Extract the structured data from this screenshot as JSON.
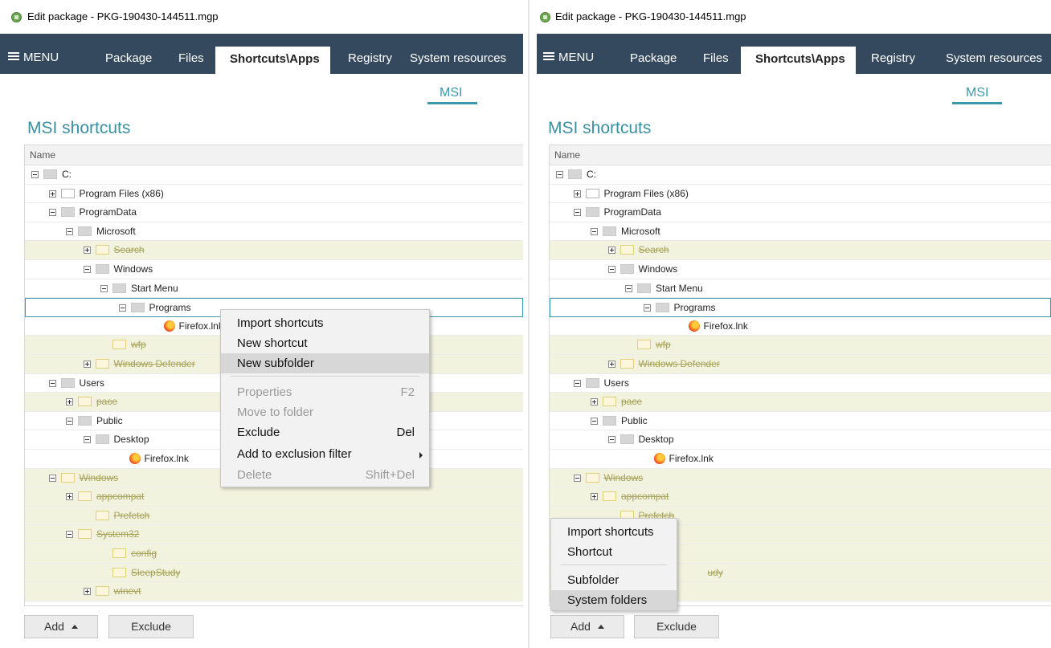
{
  "window": {
    "title": "Edit package - PKG-190430-144511.mgp"
  },
  "nav": {
    "menu_label": "MENU",
    "tabs": [
      "Package",
      "Files",
      "Shortcuts\\Apps",
      "Registry",
      "System resources"
    ],
    "active_tab": "Shortcuts\\Apps"
  },
  "subtab": {
    "label": "MSI"
  },
  "section": {
    "title": "MSI shortcuts"
  },
  "grid": {
    "column_name": "Name"
  },
  "tree_left": [
    {
      "label": "C:",
      "depth": 0,
      "toggle": "minus",
      "icon": "folder-gray",
      "excluded": false
    },
    {
      "label": "Program Files (x86)",
      "depth": 1,
      "toggle": "plus",
      "icon": "folder-outline",
      "excluded": false
    },
    {
      "label": "ProgramData",
      "depth": 1,
      "toggle": "minus",
      "icon": "folder-gray",
      "excluded": false
    },
    {
      "label": "Microsoft",
      "depth": 2,
      "toggle": "minus",
      "icon": "folder-gray",
      "excluded": false
    },
    {
      "label": "Search",
      "depth": 3,
      "toggle": "plus",
      "icon": "folder-excluded",
      "excluded": true
    },
    {
      "label": "Windows",
      "depth": 3,
      "toggle": "minus",
      "icon": "folder-gray",
      "excluded": false
    },
    {
      "label": "Start Menu",
      "depth": 4,
      "toggle": "minus",
      "icon": "folder-gray",
      "excluded": false
    },
    {
      "label": "Programs",
      "depth": 5,
      "toggle": "minus",
      "icon": "folder-gray",
      "excluded": false,
      "selected": true
    },
    {
      "label": "Firefox.lnk",
      "depth": 7,
      "toggle": "none",
      "icon": "firefox",
      "excluded": false
    },
    {
      "label": "wfp",
      "depth": 4,
      "toggle": "none",
      "icon": "folder-excluded",
      "excluded": true
    },
    {
      "label": "Windows Defender",
      "depth": 3,
      "toggle": "plus",
      "icon": "folder-excluded",
      "excluded": true
    },
    {
      "label": "Users",
      "depth": 1,
      "toggle": "minus",
      "icon": "folder-gray",
      "excluded": false
    },
    {
      "label": "pace",
      "depth": 2,
      "toggle": "plus",
      "icon": "folder-excluded",
      "excluded": true
    },
    {
      "label": "Public",
      "depth": 2,
      "toggle": "minus",
      "icon": "folder-gray",
      "excluded": false
    },
    {
      "label": "Desktop",
      "depth": 3,
      "toggle": "minus",
      "icon": "folder-gray",
      "excluded": false
    },
    {
      "label": "Firefox.lnk",
      "depth": 5,
      "toggle": "none",
      "icon": "firefox",
      "excluded": false
    },
    {
      "label": "Windows",
      "depth": 1,
      "toggle": "minus",
      "icon": "folder-excluded",
      "excluded": true
    },
    {
      "label": "appcompat",
      "depth": 2,
      "toggle": "plus",
      "icon": "folder-excluded",
      "excluded": true
    },
    {
      "label": "Prefetch",
      "depth": 3,
      "toggle": "none",
      "icon": "folder-excluded",
      "excluded": true
    },
    {
      "label": "System32",
      "depth": 2,
      "toggle": "minus",
      "icon": "folder-excluded",
      "excluded": true
    },
    {
      "label": "config",
      "depth": 4,
      "toggle": "none",
      "icon": "folder-excluded",
      "excluded": true
    },
    {
      "label": "SleepStudy",
      "depth": 4,
      "toggle": "none",
      "icon": "folder-excluded",
      "excluded": true
    },
    {
      "label": "winevt",
      "depth": 3,
      "toggle": "plus",
      "icon": "folder-excluded",
      "excluded": true
    }
  ],
  "tree_right": [
    {
      "label": "C:",
      "depth": 0,
      "toggle": "minus",
      "icon": "folder-gray",
      "excluded": false
    },
    {
      "label": "Program Files (x86)",
      "depth": 1,
      "toggle": "plus",
      "icon": "folder-outline",
      "excluded": false
    },
    {
      "label": "ProgramData",
      "depth": 1,
      "toggle": "minus",
      "icon": "folder-gray",
      "excluded": false
    },
    {
      "label": "Microsoft",
      "depth": 2,
      "toggle": "minus",
      "icon": "folder-gray",
      "excluded": false
    },
    {
      "label": "Search",
      "depth": 3,
      "toggle": "plus",
      "icon": "folder-excluded",
      "excluded": true
    },
    {
      "label": "Windows",
      "depth": 3,
      "toggle": "minus",
      "icon": "folder-gray",
      "excluded": false
    },
    {
      "label": "Start Menu",
      "depth": 4,
      "toggle": "minus",
      "icon": "folder-gray",
      "excluded": false
    },
    {
      "label": "Programs",
      "depth": 5,
      "toggle": "minus",
      "icon": "folder-gray",
      "excluded": false,
      "selected": true
    },
    {
      "label": "Firefox.lnk",
      "depth": 7,
      "toggle": "none",
      "icon": "firefox",
      "excluded": false
    },
    {
      "label": "wfp",
      "depth": 4,
      "toggle": "none",
      "icon": "folder-excluded",
      "excluded": true
    },
    {
      "label": "Windows Defender",
      "depth": 3,
      "toggle": "plus",
      "icon": "folder-excluded",
      "excluded": true
    },
    {
      "label": "Users",
      "depth": 1,
      "toggle": "minus",
      "icon": "folder-gray",
      "excluded": false
    },
    {
      "label": "pace",
      "depth": 2,
      "toggle": "plus",
      "icon": "folder-excluded",
      "excluded": true
    },
    {
      "label": "Public",
      "depth": 2,
      "toggle": "minus",
      "icon": "folder-gray",
      "excluded": false
    },
    {
      "label": "Desktop",
      "depth": 3,
      "toggle": "minus",
      "icon": "folder-gray",
      "excluded": false
    },
    {
      "label": "Firefox.lnk",
      "depth": 5,
      "toggle": "none",
      "icon": "firefox",
      "excluded": false
    },
    {
      "label": "Windows",
      "depth": 1,
      "toggle": "minus",
      "icon": "folder-excluded",
      "excluded": true
    },
    {
      "label": "appcompat",
      "depth": 2,
      "toggle": "plus",
      "icon": "folder-excluded",
      "excluded": true
    },
    {
      "label": "Prefetch",
      "depth": 3,
      "toggle": "none",
      "icon": "folder-excluded",
      "excluded": true
    },
    {
      "label": "",
      "depth": 2,
      "toggle": "none",
      "icon": "none",
      "excluded": true
    },
    {
      "label": "",
      "depth": 4,
      "toggle": "none",
      "icon": "none",
      "excluded": true
    },
    {
      "label": "udy",
      "depth": 7,
      "toggle": "none",
      "icon": "none",
      "excluded": true
    },
    {
      "label": "",
      "depth": 3,
      "toggle": "none",
      "icon": "none",
      "excluded": true
    }
  ],
  "context_menu": {
    "items": [
      {
        "label": "Import shortcuts",
        "shortcut": "",
        "disabled": false
      },
      {
        "label": "New shortcut",
        "shortcut": "",
        "disabled": false
      },
      {
        "label": "New subfolder",
        "shortcut": "",
        "disabled": false,
        "highlighted": true
      },
      {
        "label": "Properties",
        "shortcut": "F2",
        "disabled": true
      },
      {
        "label": "Move to folder",
        "shortcut": "",
        "disabled": true
      },
      {
        "label": "Exclude",
        "shortcut": "Del",
        "disabled": false
      },
      {
        "label": "Add to exclusion filter",
        "shortcut": "",
        "disabled": false,
        "submenu": true
      },
      {
        "label": "Delete",
        "shortcut": "Shift+Del",
        "disabled": true
      }
    ]
  },
  "add_menu": {
    "items": [
      {
        "label": "Import shortcuts"
      },
      {
        "label": "Shortcut"
      },
      {
        "label": "Subfolder"
      },
      {
        "label": "System folders",
        "highlighted": true
      }
    ]
  },
  "buttons": {
    "add": "Add",
    "exclude": "Exclude"
  },
  "colors": {
    "nav_bg": "#34495e",
    "accent": "#3a99a8",
    "excluded_row_bg": "#f2f3df"
  }
}
